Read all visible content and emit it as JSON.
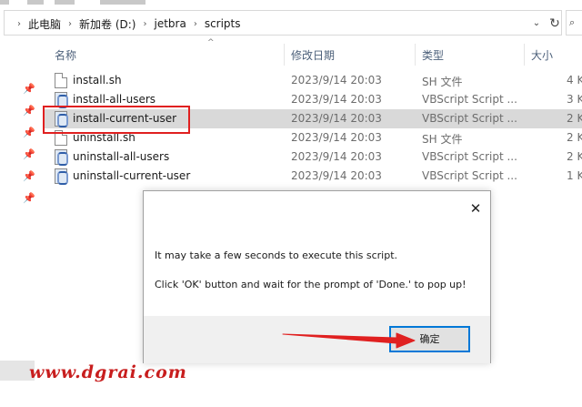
{
  "breadcrumb": {
    "items": [
      "此电脑",
      "新加卷 (D:)",
      "jetbra",
      "scripts"
    ],
    "separator": "›"
  },
  "columns": {
    "name": "名称",
    "date": "修改日期",
    "type": "类型",
    "size": "大小"
  },
  "files": [
    {
      "name": "install.sh",
      "date": "2023/9/14 20:03",
      "type": "SH 文件",
      "size": "4 K",
      "icon": "sh-file-icon"
    },
    {
      "name": "install-all-users",
      "date": "2023/9/14 20:03",
      "type": "VBScript Script ...",
      "size": "3 K",
      "icon": "vbscript-file-icon"
    },
    {
      "name": "install-current-user",
      "date": "2023/9/14 20:03",
      "type": "VBScript Script ...",
      "size": "2 K",
      "icon": "vbscript-file-icon",
      "selected": true
    },
    {
      "name": "uninstall.sh",
      "date": "2023/9/14 20:03",
      "type": "SH 文件",
      "size": "2 K",
      "icon": "sh-file-icon"
    },
    {
      "name": "uninstall-all-users",
      "date": "2023/9/14 20:03",
      "type": "VBScript Script ...",
      "size": "2 K",
      "icon": "vbscript-file-icon"
    },
    {
      "name": "uninstall-current-user",
      "date": "2023/9/14 20:03",
      "type": "VBScript Script ...",
      "size": "1 K",
      "icon": "vbscript-file-icon"
    }
  ],
  "dialog": {
    "message_line1": "It may take a few seconds to execute this script.",
    "message_line2": "Click 'OK' button and wait for the prompt of 'Done.' to pop up!",
    "ok_label": "确定",
    "close_glyph": "✕"
  },
  "watermark": "www.dgrai.com",
  "colors": {
    "highlight_red": "#e02020",
    "selection_gray": "#d9d9d9",
    "focus_blue": "#0078d7",
    "watermark_red": "#c81e1e"
  }
}
